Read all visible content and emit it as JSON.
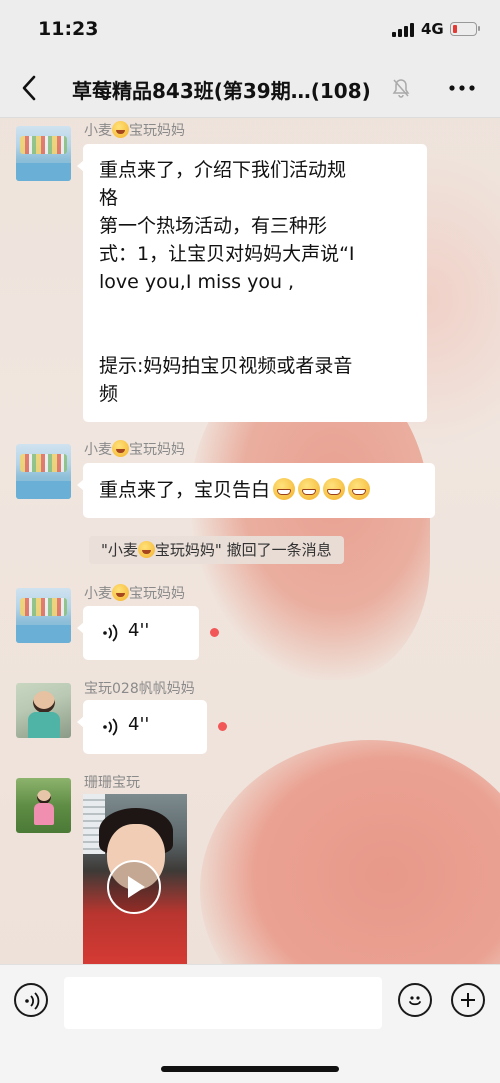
{
  "status_bar": {
    "time": "11:23",
    "network": "4G"
  },
  "header": {
    "title": "草莓精品843班(第39期…(108)"
  },
  "messages": [
    {
      "sender_prefix": "小麦",
      "sender_suffix": "宝玩妈妈",
      "text": "重点来了，介绍下我们活动规\n格\n第一个热场活动，有三种形\n式：1，让宝贝对妈妈大声说“I\nlove you,I miss you ,\n\n\n提示:妈妈拍宝贝视频或者录音\n频"
    },
    {
      "sender_prefix": "小麦",
      "sender_suffix": "宝玩妈妈",
      "text": "重点来了，宝贝告白"
    },
    {
      "system_prefix": "\"小麦",
      "system_suffix": "宝玩妈妈\" 撤回了一条消息"
    },
    {
      "sender_prefix": "小麦",
      "sender_suffix": "宝玩妈妈",
      "voice_duration": "4''"
    },
    {
      "sender": "宝玩028帆帆妈妈",
      "voice_duration": "4''"
    },
    {
      "sender": "珊珊宝玩"
    }
  ],
  "colors": {
    "unread_dot": "#f25656",
    "bubble": "#ffffff",
    "status_bar": "#ededed"
  }
}
